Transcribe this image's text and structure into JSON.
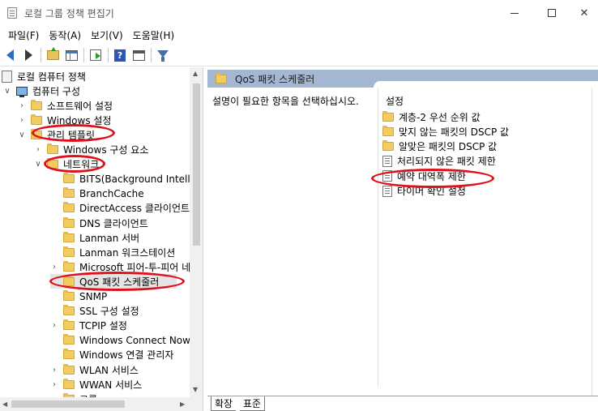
{
  "window": {
    "title": "로컬 그룹 정책 편집기"
  },
  "menu": [
    "파일(F)",
    "동작(A)",
    "보기(V)",
    "도움말(H)"
  ],
  "toolbar": {
    "help_glyph": "?"
  },
  "tree": {
    "items": [
      {
        "label": "로컬 컴퓨터 정책",
        "level": 0,
        "expander": "",
        "icon": "root"
      },
      {
        "label": "컴퓨터 구성",
        "level": 1,
        "expander": "∨",
        "icon": "computer"
      },
      {
        "label": "소프트웨어 설정",
        "level": 2,
        "expander": "›",
        "icon": "folder"
      },
      {
        "label": "Windows 설정",
        "level": 2,
        "expander": "›",
        "icon": "folder"
      },
      {
        "label": "관리 템플릿",
        "level": 2,
        "expander": "∨",
        "icon": "folder"
      },
      {
        "label": "Windows 구성 요소",
        "level": 3,
        "expander": "›",
        "icon": "folder"
      },
      {
        "label": "네트워크",
        "level": 3,
        "expander": "∨",
        "icon": "folder"
      },
      {
        "label": "BITS(Background Intelligent Transfer Service)",
        "level": 4,
        "expander": "",
        "icon": "folder"
      },
      {
        "label": "BranchCache",
        "level": 4,
        "expander": "",
        "icon": "folder"
      },
      {
        "label": "DirectAccess 클라이언트 환경",
        "level": 4,
        "expander": "",
        "icon": "folder"
      },
      {
        "label": "DNS 클라이언트",
        "level": 4,
        "expander": "",
        "icon": "folder"
      },
      {
        "label": "Lanman 서버",
        "level": 4,
        "expander": "",
        "icon": "folder"
      },
      {
        "label": "Lanman 워크스테이션",
        "level": 4,
        "expander": "",
        "icon": "folder"
      },
      {
        "label": "Microsoft 피어-투-피어 네트워킹 서비스",
        "level": 4,
        "expander": "›",
        "icon": "folder"
      },
      {
        "label": "QoS 패킷 스케줄러",
        "level": 4,
        "expander": "",
        "icon": "folder",
        "selected": true
      },
      {
        "label": "SNMP",
        "level": 4,
        "expander": "",
        "icon": "folder"
      },
      {
        "label": "SSL 구성 설정",
        "level": 4,
        "expander": "",
        "icon": "folder"
      },
      {
        "label": "TCPIP 설정",
        "level": 4,
        "expander": "›",
        "icon": "folder"
      },
      {
        "label": "Windows Connect Now",
        "level": 4,
        "expander": "",
        "icon": "folder"
      },
      {
        "label": "Windows 연결 관리자",
        "level": 4,
        "expander": "",
        "icon": "folder"
      },
      {
        "label": "WLAN 서비스",
        "level": 4,
        "expander": "›",
        "icon": "folder"
      },
      {
        "label": "WWAN 서비스",
        "level": 4,
        "expander": "›",
        "icon": "folder"
      },
      {
        "label": "그룹",
        "level": 4,
        "expander": "›",
        "icon": "folder"
      }
    ]
  },
  "details": {
    "header": "QoS 패킷 스케줄러",
    "description_prompt": "설명이 필요한 항목을 선택하십시오.",
    "settings_column": "설정",
    "settings": [
      {
        "label": "계층-2 우선 순위 값",
        "icon": "folder"
      },
      {
        "label": "맞지 않는 패킷의 DSCP 값",
        "icon": "folder"
      },
      {
        "label": "알맞은 패킷의 DSCP 값",
        "icon": "folder"
      },
      {
        "label": "처리되지 않은 패킷 제한",
        "icon": "policy"
      },
      {
        "label": "예약 대역폭 제한",
        "icon": "policy"
      },
      {
        "label": "타이머 확인 설정",
        "icon": "policy"
      }
    ]
  },
  "tabs": {
    "extended": "확장",
    "standard": "표준"
  },
  "annotation_color": "#e0101b"
}
